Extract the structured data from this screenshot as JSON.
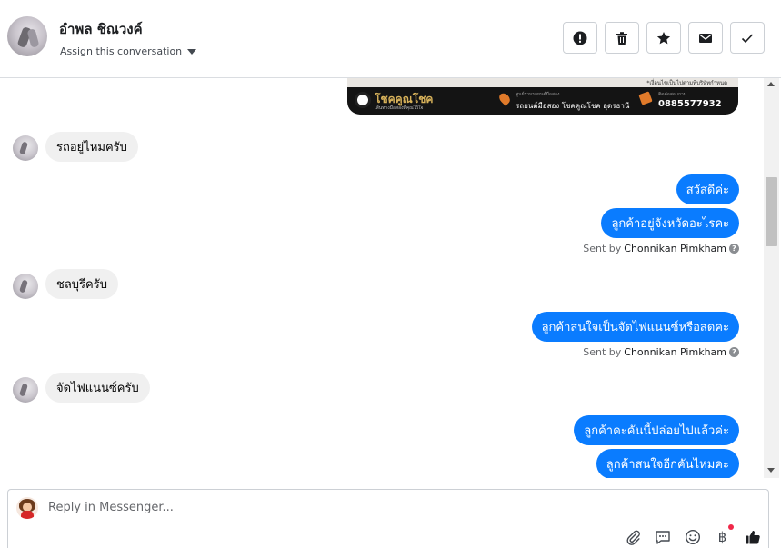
{
  "header": {
    "contact_name": "อำพล ชิณวงค์",
    "assign_label": "Assign this conversation",
    "actions": [
      {
        "name": "mark-spam-button",
        "icon": "exclamation-circle-icon"
      },
      {
        "name": "delete-button",
        "icon": "trash-icon"
      },
      {
        "name": "star-button",
        "icon": "star-icon"
      },
      {
        "name": "mark-unread-button",
        "icon": "envelope-icon"
      },
      {
        "name": "mark-done-button",
        "icon": "check-icon"
      }
    ]
  },
  "banner": {
    "notice": "*เงื่อนไขเป็นไปตามที่บริษัทกำหนด",
    "brand": "โชคคูณโชค",
    "brand_sub": "เส้นทางมือสองที่คุณไว้ใจ",
    "address_label": "ศูนย์รวมรถยนต์มือสอง",
    "address": "รถยนต์มือสอง โชคคูณโชค อุดรธานี",
    "phone_label": "ติดต่อสอบถาม",
    "phone": "0885577932"
  },
  "messages": {
    "in_1": "รถอยู่ไหมครับ",
    "out_1": "สวัสดีค่ะ",
    "out_2": "ลูกค้าอยู่จังหวัดอะไรคะ",
    "sent_by_1_prefix": "Sent by",
    "sent_by_1_name": "Chonnikan Pimkham",
    "in_2": "ชลบุรีครับ",
    "out_3": "ลูกค้าสนใจเป็นจัดไฟแนนซ์หรือสดคะ",
    "sent_by_2_prefix": "Sent by",
    "sent_by_2_name": "Chonnikan Pimkham",
    "in_3": "จัดไฟแนนซ์ครับ",
    "out_4": "ลูกค้าคะคันนี้ปล่อยไปแล้วค่ะ",
    "out_5": "ลูกค้าสนใจอีกคันไหมคะ"
  },
  "composer": {
    "placeholder": "Reply in Messenger...",
    "tools": [
      "paperclip-icon",
      "saved-reply-icon",
      "emoji-icon",
      "baht-payment-icon",
      "thumbs-up-icon"
    ]
  },
  "colors": {
    "outgoing_bubble": "#0a7cff",
    "incoming_bubble": "#f0f0f0"
  }
}
